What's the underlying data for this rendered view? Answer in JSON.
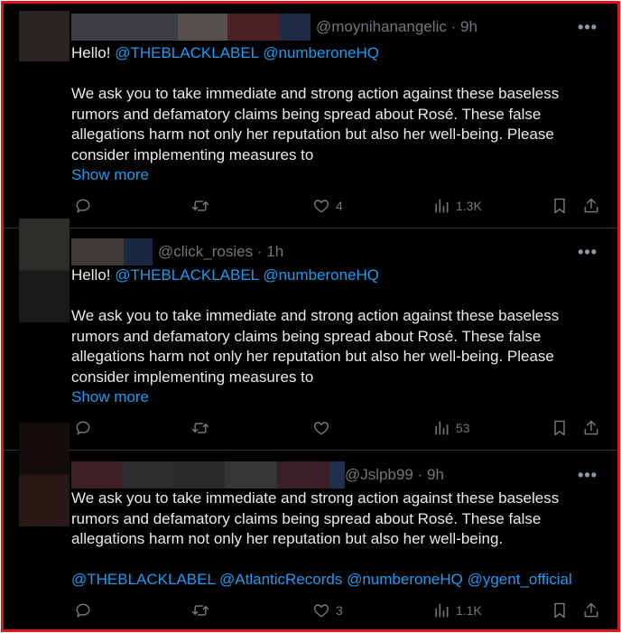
{
  "tweets": [
    {
      "handle": "@moynihanangelic",
      "time": "9h",
      "mentions_line": [
        "Hello!",
        "@THEBLACKLABEL",
        "@numberoneHQ"
      ],
      "paragraph": "We ask you to take immediate and strong action against these baseless rumors and defamatory claims being spread about Rosé. These false allegations harm not only her reputation but also her well-being. Please consider implementing measures to",
      "show_more": "Show more",
      "likes": "4",
      "views": "1.3K"
    },
    {
      "handle": "@click_rosies",
      "time": "1h",
      "mentions_line": [
        "Hello!",
        "@THEBLACKLABEL",
        "@numberoneHQ"
      ],
      "paragraph": "We ask you to take immediate and strong action against these baseless rumors and defamatory claims being spread about Rosé. These false allegations harm not only her reputation but also her well-being. Please consider implementing measures to",
      "show_more": "Show more",
      "likes": "",
      "views": "53"
    },
    {
      "handle": "@Jslpb99",
      "time": "9h",
      "paragraph": "We ask you to take immediate and strong action against these baseless rumors and defamatory claims being spread about Rosé. These false allegations harm not only her reputation but also her well-being.",
      "mentions_line": [
        "@THEBLACKLABEL",
        "@AtlanticRecords",
        "@numberoneHQ",
        "@ygent_official"
      ],
      "likes": "3",
      "views": "1.1K"
    }
  ],
  "separator": "·",
  "more_glyph": "•••",
  "colors": {
    "background": "#000000",
    "text": "#e7e9ea",
    "muted": "#71767b",
    "link": "#1d9bf0",
    "frame": "#e0141b"
  },
  "icons": [
    "reply-icon",
    "retweet-icon",
    "like-icon",
    "views-icon",
    "bookmark-icon",
    "share-icon",
    "more-icon"
  ]
}
